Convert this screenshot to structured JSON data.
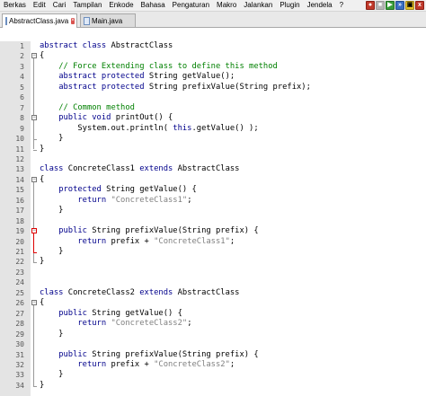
{
  "menubar": {
    "items": [
      "Berkas",
      "Edit",
      "Cari",
      "Tampilan",
      "Enkode",
      "Bahasa",
      "Pengaturan",
      "Makro",
      "Jalankan",
      "Plugin",
      "Jendela",
      "?"
    ]
  },
  "tabs": [
    {
      "label": "AbstractClass.java",
      "active": true,
      "close": "x"
    },
    {
      "label": "Main.java",
      "active": false
    }
  ],
  "toolbar_icons": [
    "record-icon",
    "stop-icon",
    "play-icon",
    "play-multiple-icon",
    "save-macro-icon",
    "x-icon"
  ],
  "editor": {
    "lines": [
      {
        "n": "1",
        "code": "abstract class AbstractClass"
      },
      {
        "n": "2",
        "code": "{"
      },
      {
        "n": "3",
        "code": "    // Force Extending class to define this method"
      },
      {
        "n": "4",
        "code": "    abstract protected String getValue();"
      },
      {
        "n": "5",
        "code": "    abstract protected String prefixValue(String prefix);"
      },
      {
        "n": "6",
        "code": ""
      },
      {
        "n": "7",
        "code": "    // Common method"
      },
      {
        "n": "8",
        "code": "    public void printOut() {"
      },
      {
        "n": "9",
        "code": "        System.out.println( this.getValue() );"
      },
      {
        "n": "10",
        "code": "    }"
      },
      {
        "n": "11",
        "code": "}"
      },
      {
        "n": "12",
        "code": ""
      },
      {
        "n": "13",
        "code": "class ConcreteClass1 extends AbstractClass"
      },
      {
        "n": "14",
        "code": "{"
      },
      {
        "n": "15",
        "code": "    protected String getValue() {"
      },
      {
        "n": "16",
        "code": "        return \"ConcreteClass1\";"
      },
      {
        "n": "17",
        "code": "    }"
      },
      {
        "n": "18",
        "code": ""
      },
      {
        "n": "19",
        "code": "    public String prefixValue(String prefix) {"
      },
      {
        "n": "20",
        "code": "        return prefix + \"ConcreteClass1\";"
      },
      {
        "n": "21",
        "code": "    }"
      },
      {
        "n": "22",
        "code": "}"
      },
      {
        "n": "23",
        "code": ""
      },
      {
        "n": "24",
        "code": ""
      },
      {
        "n": "25",
        "code": "class ConcreteClass2 extends AbstractClass"
      },
      {
        "n": "26",
        "code": "{"
      },
      {
        "n": "27",
        "code": "    public String getValue() {"
      },
      {
        "n": "28",
        "code": "        return \"ConcreteClass2\";"
      },
      {
        "n": "29",
        "code": "    }"
      },
      {
        "n": "30",
        "code": ""
      },
      {
        "n": "31",
        "code": "    public String prefixValue(String prefix) {"
      },
      {
        "n": "32",
        "code": "        return prefix + \"ConcreteClass2\";"
      },
      {
        "n": "33",
        "code": "    }"
      },
      {
        "n": "34",
        "code": "}"
      }
    ]
  },
  "colors": {
    "keyword": "#00008b",
    "comment": "#008000",
    "string": "#808080",
    "gutter": "#e4e4e4",
    "brace_match": "#d00000"
  }
}
